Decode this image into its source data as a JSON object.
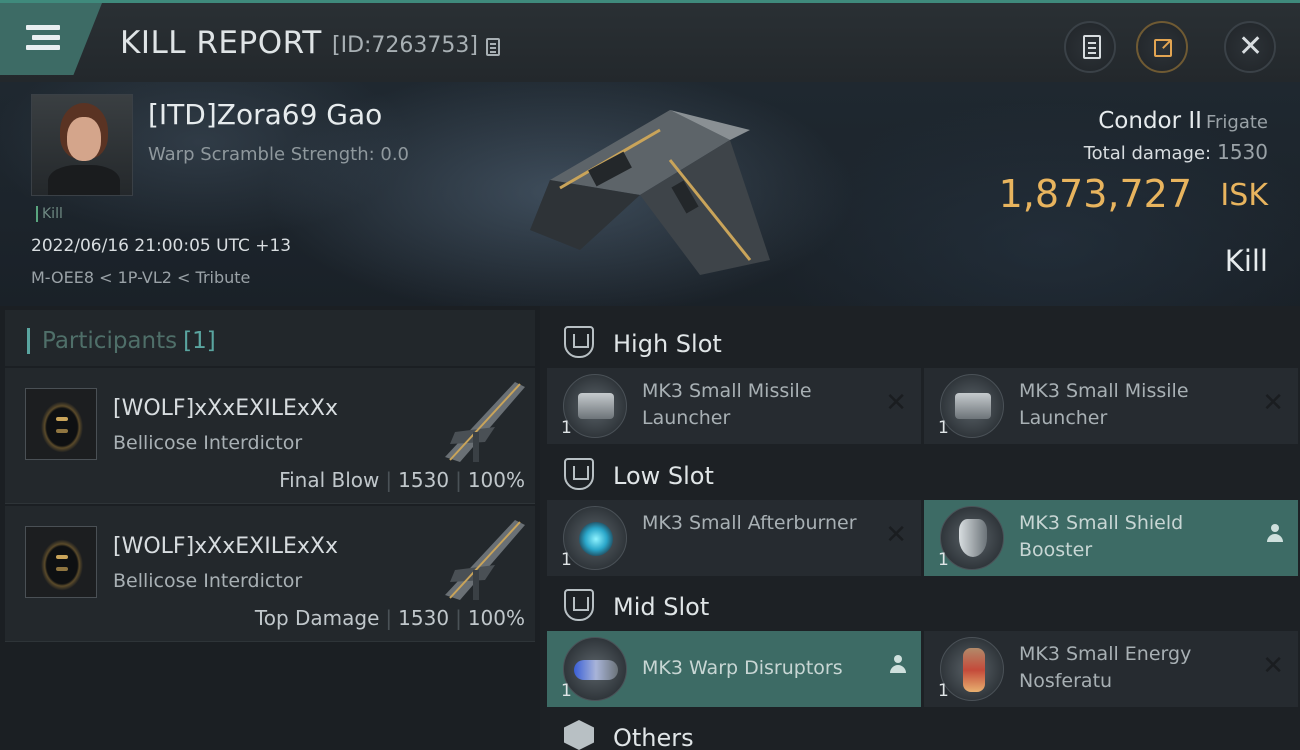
{
  "header": {
    "title": "KILL REPORT",
    "report_id": "[ID:7263753]"
  },
  "victim": {
    "pilot": "[ITD]Zora69 Gao",
    "warp_scramble": "Warp Scramble Strength: 0.0",
    "kill_tag": "Kill",
    "time": "2022/06/16 21:00:05 UTC +13",
    "location": "M-OEE8 < 1P-VL2 < Tribute",
    "ship": "Condor II",
    "ship_class": "Frigate",
    "total_damage_label": "Total damage:",
    "total_damage": "1530",
    "isk_value": "1,873,727",
    "isk_unit": "ISK",
    "type": "Kill"
  },
  "participants": {
    "label": "Participants",
    "count": "[1]",
    "rows": [
      {
        "name": "[WOLF]xXxEXILExXx",
        "ship": "Bellicose Interdictor",
        "role": "Final Blow",
        "damage": "1530",
        "percent": "100%"
      },
      {
        "name": "[WOLF]xXxEXILExXx",
        "ship": "Bellicose Interdictor",
        "role": "Top Damage",
        "damage": "1530",
        "percent": "100%"
      }
    ]
  },
  "fitting": {
    "high": {
      "label": "High Slot",
      "modules": [
        {
          "name": "MK3 Small Missile Launcher",
          "qty": "1"
        },
        {
          "name": "MK3 Small Missile Launcher",
          "qty": "1"
        }
      ]
    },
    "low": {
      "label": "Low Slot",
      "modules": [
        {
          "name": "MK3 Small Afterburner",
          "qty": "1"
        },
        {
          "name": "MK3 Small Shield Booster",
          "qty": "1"
        }
      ]
    },
    "mid": {
      "label": "Mid Slot",
      "modules": [
        {
          "name": "MK3 Warp Disruptors",
          "qty": "1"
        },
        {
          "name": "MK3 Small Energy Nosferatu",
          "qty": "1"
        }
      ]
    },
    "others": {
      "label": "Others"
    }
  },
  "icons": {
    "menu": "menu-icon",
    "copy": "copy-icon",
    "clipboard": "clipboard-icon",
    "share": "share-icon",
    "close": "close-icon",
    "slot": "slot-icon",
    "others": "cube-icon",
    "destroyed": "x-icon",
    "dropped": "person-icon"
  },
  "colors": {
    "accent": "#3d6b65",
    "isk": "#e8b45e",
    "teal": "#5aa5a0"
  }
}
